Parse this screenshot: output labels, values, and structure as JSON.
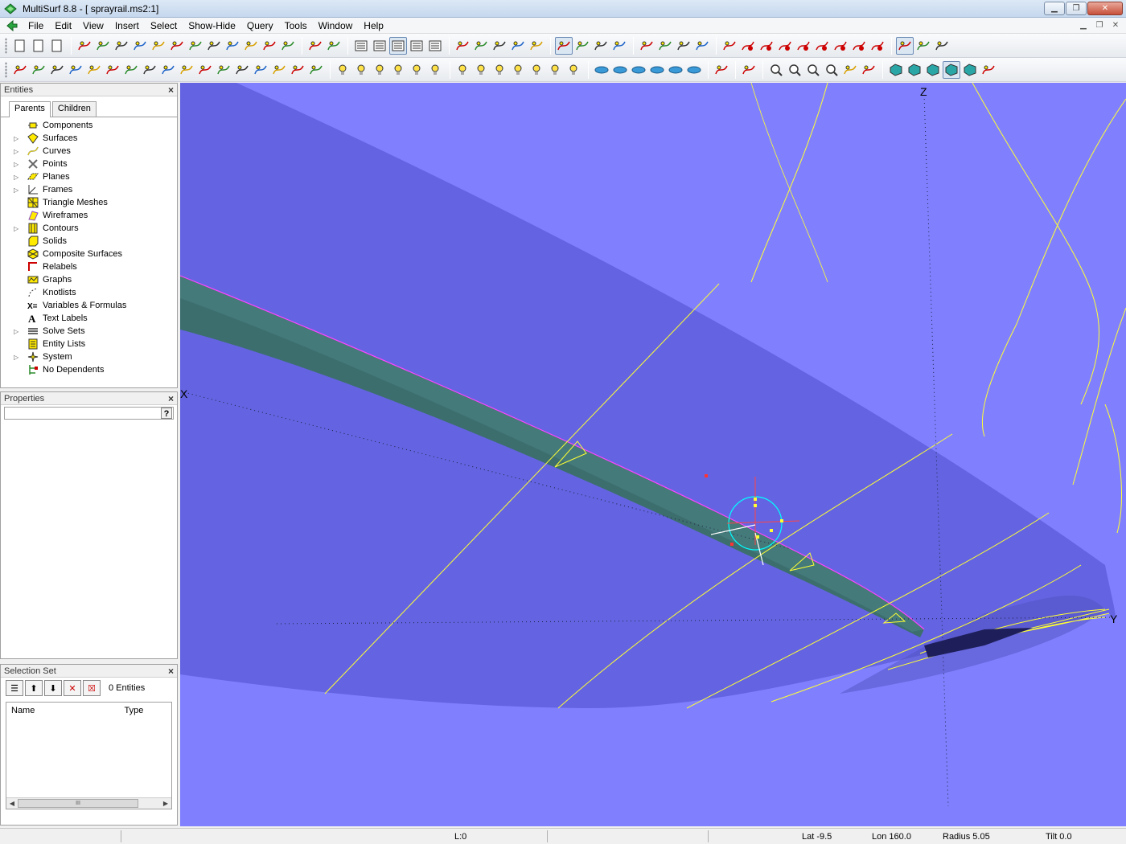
{
  "window": {
    "title": "MultiSurf 8.8 - [ sprayrail.ms2:1]"
  },
  "menu": [
    "File",
    "Edit",
    "View",
    "Insert",
    "Select",
    "Show-Hide",
    "Query",
    "Tools",
    "Window",
    "Help"
  ],
  "entities_panel": {
    "title": "Entities",
    "tabs": [
      "Parents",
      "Children"
    ],
    "active_tab": "Parents",
    "items": [
      {
        "label": "Components",
        "icon": "components-icon",
        "expandable": false
      },
      {
        "label": "Surfaces",
        "icon": "surface-icon",
        "expandable": true
      },
      {
        "label": "Curves",
        "icon": "curve-icon",
        "expandable": true
      },
      {
        "label": "Points",
        "icon": "point-icon",
        "expandable": true
      },
      {
        "label": "Planes",
        "icon": "plane-icon",
        "expandable": true
      },
      {
        "label": "Frames",
        "icon": "frame-icon",
        "expandable": true
      },
      {
        "label": "Triangle Meshes",
        "icon": "triangle-mesh-icon",
        "expandable": false
      },
      {
        "label": "Wireframes",
        "icon": "wireframe-icon",
        "expandable": false
      },
      {
        "label": "Contours",
        "icon": "contour-icon",
        "expandable": true
      },
      {
        "label": "Solids",
        "icon": "solid-icon",
        "expandable": false
      },
      {
        "label": "Composite Surfaces",
        "icon": "composite-surface-icon",
        "expandable": false
      },
      {
        "label": "Relabels",
        "icon": "relabel-icon",
        "expandable": false
      },
      {
        "label": "Graphs",
        "icon": "graph-icon",
        "expandable": false
      },
      {
        "label": "Knotlists",
        "icon": "knotlist-icon",
        "expandable": false
      },
      {
        "label": "Variables & Formulas",
        "icon": "variable-icon",
        "expandable": false
      },
      {
        "label": "Text Labels",
        "icon": "text-label-icon",
        "expandable": false
      },
      {
        "label": "Solve Sets",
        "icon": "solve-set-icon",
        "expandable": true
      },
      {
        "label": "Entity Lists",
        "icon": "entity-list-icon",
        "expandable": false
      },
      {
        "label": "System",
        "icon": "system-icon",
        "expandable": true
      },
      {
        "label": "No Dependents",
        "icon": "no-dependents-icon",
        "expandable": false
      }
    ]
  },
  "properties_panel": {
    "title": "Properties",
    "help": "?"
  },
  "selection_panel": {
    "title": "Selection Set",
    "count_label": "0 Entities",
    "columns": [
      "Name",
      "Type"
    ],
    "scroll_thumb": "III"
  },
  "viewport": {
    "axis_labels": {
      "x": "X",
      "y": "Y",
      "z": "Z"
    },
    "colors": {
      "background": "#8080ff",
      "surface": "#6464e0",
      "rail": "#3c6e6e",
      "wire": "#ffff33",
      "highlight": "#ff44ff"
    }
  },
  "status": {
    "layer": "L:0",
    "lat": "Lat -9.5",
    "lon": "Lon 160.0",
    "radius": "Radius 5.05",
    "tilt": "Tilt 0.0"
  },
  "toolbar1_groups": [
    [
      "new-file-icon",
      "open-file-icon",
      "save-file-icon"
    ],
    [
      "point-tool-icon",
      "curve-tool-icon",
      "snake-tool-icon",
      "bead-tool-icon",
      "spline-tool-icon",
      "arc-tool-icon",
      "ring-tool-icon",
      "surface-tool-icon",
      "blend-tool-icon",
      "fill-tool-icon",
      "solid-tool-icon",
      "composite-tool-icon"
    ],
    [
      "mesh-tool-icon",
      "offset-tool-icon"
    ],
    [
      "view-tree-icon",
      "view-list-icon",
      "view-details-icon",
      "view-table-icon",
      "view-report-icon"
    ],
    [
      "hide-icon",
      "show-icon",
      "show-all-icon",
      "hide-all-icon",
      "query-icon"
    ],
    [
      "select-arrow-icon",
      "dots-grid-icon",
      "dots-grid2-icon",
      "move-icon"
    ],
    [
      "measure-icon",
      "dimension-icon",
      "dimension2-icon",
      "snap-icon"
    ],
    [
      "grid-icon",
      "red-curve-icon",
      "red-curve2-icon",
      "red-surface-icon",
      "red-surface2-icon",
      "red-surface3-icon",
      "red-surface4-icon",
      "red-surface5-icon",
      "red-surface6-icon"
    ],
    [
      "arrow-select-icon",
      "drag-tool-icon",
      "pick-tool-icon"
    ]
  ],
  "toolbar2_groups": [
    [
      "entity-point-icon",
      "entity-curve-icon",
      "entity-snake-icon",
      "entity-spline-icon",
      "entity-arc-icon",
      "entity-surface-icon",
      "entity-blend-icon",
      "entity-fill-icon",
      "entity-mesh-icon",
      "entity-frame-icon",
      "entity-plane-icon",
      "entity-contour-icon",
      "entity-graph-icon",
      "entity-solid-icon",
      "entity-composite-icon",
      "entity-list-icon",
      "entity-other-icon"
    ],
    [
      "light-icon",
      "bulb-on-icon",
      "bulb-x-icon",
      "bulb-ring-icon",
      "bulb-plus-icon",
      "bulb-off-icon"
    ],
    [
      "lamp-icon",
      "lamp-on-icon",
      "lamp-x-icon",
      "lamp-ring-icon",
      "lamp-plus-icon",
      "lamp-minus-icon",
      "lamp-off-icon"
    ],
    [
      "view-front-icon",
      "view-top-icon",
      "view-side-icon",
      "view-iso-icon",
      "view-bottom-icon",
      "view-back-icon"
    ],
    [
      "home-view-icon"
    ],
    [
      "pick-point-icon"
    ],
    [
      "zoom-window-icon",
      "zoom-in-icon",
      "zoom-fit-icon",
      "zoom-out-icon",
      "rotate-view-icon",
      "pan-view-icon"
    ],
    [
      "wireframe-view-icon",
      "shaded-view-icon",
      "shaded-edges-icon",
      "shaded-outline-icon",
      "gray-shade-icon",
      "render-icon"
    ]
  ]
}
